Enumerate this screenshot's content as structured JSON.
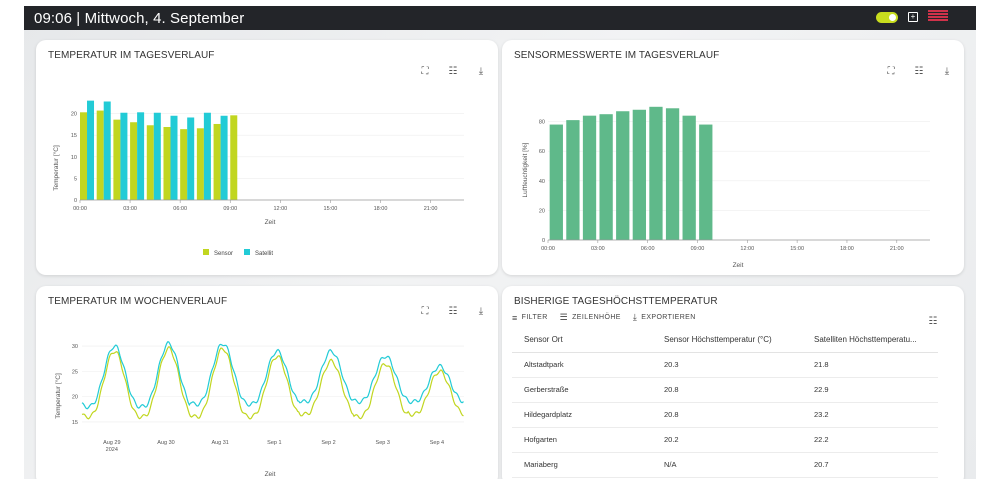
{
  "header": {
    "clock": "09:06 | Mittwoch, 4. September"
  },
  "colors": {
    "sensor": "#c1d620",
    "satellite": "#22cbd6",
    "humidity": "#5fb98a"
  },
  "icons": [
    "fullscreen-icon",
    "sliders-icon",
    "download-icon"
  ],
  "card1": {
    "title": "TEMPERATUR IM TAGESVERLAUF",
    "ylabel": "Temperatur [°C]",
    "xlabel": "Zeit",
    "legend": [
      "Sensor",
      "Satellit"
    ]
  },
  "card2": {
    "title": "SENSORMESSWERTE IM TAGESVERLAUF",
    "ylabel": "Luftfeuchtigkeit [%]",
    "xlabel": "Zeit"
  },
  "card3": {
    "title": "TEMPERATUR IM WOCHENVERLAUF",
    "ylabel": "Temperatur [°C]",
    "xlabel": "Zeit"
  },
  "card4": {
    "title": "BISHERIGE TAGESHÖCHSTTEMPERATUR",
    "toolbar": {
      "filter": "FILTER",
      "rowheight": "ZEILENHÖHE",
      "export": "EXPORTIEREN"
    },
    "columns": [
      "Sensor Ort",
      "Sensor Höchsttemperatur (°C)",
      "Satelliten Höchsttemperatu..."
    ],
    "rows": [
      [
        "Altstadtpark",
        "20.3",
        "21.8"
      ],
      [
        "Gerberstraße",
        "20.8",
        "22.9"
      ],
      [
        "Hildegardplatz",
        "20.8",
        "23.2"
      ],
      [
        "Hofgarten",
        "20.2",
        "22.2"
      ],
      [
        "Mariaberg",
        "N/A",
        "20.7"
      ]
    ]
  },
  "chart_data": [
    {
      "type": "bar",
      "x_ticks": [
        "00:00",
        "03:00",
        "06:00",
        "09:00",
        "12:00",
        "15:00",
        "18:00",
        "21:00"
      ],
      "ylim": [
        0,
        25
      ],
      "y_ticks": [
        0,
        5,
        10,
        15,
        20
      ],
      "x": [
        "00:00",
        "01:00",
        "02:00",
        "03:00",
        "04:00",
        "05:00",
        "06:00",
        "07:00",
        "08:00",
        "09:00"
      ],
      "series": [
        {
          "name": "Sensor",
          "values": [
            20.3,
            20.7,
            18.6,
            18.0,
            17.3,
            16.9,
            16.4,
            16.6,
            17.6,
            19.6
          ]
        },
        {
          "name": "Satellit",
          "values": [
            23.0,
            22.8,
            20.2,
            20.3,
            20.2,
            19.5,
            19.1,
            20.2,
            19.5,
            null
          ]
        }
      ],
      "ylabel": "Temperatur [°C]",
      "xlabel": "Zeit",
      "legend": "bottom",
      "grid": true
    },
    {
      "type": "bar",
      "x_ticks": [
        "00:00",
        "03:00",
        "06:00",
        "09:00",
        "12:00",
        "15:00",
        "18:00",
        "21:00"
      ],
      "ylim": [
        0,
        100
      ],
      "y_ticks": [
        0,
        20,
        40,
        60,
        80
      ],
      "x": [
        "00:00",
        "01:00",
        "02:00",
        "03:00",
        "04:00",
        "05:00",
        "06:00",
        "07:00",
        "08:00",
        "09:00"
      ],
      "values": [
        78,
        81,
        84,
        85,
        87,
        88,
        90,
        89,
        84,
        78
      ],
      "ylabel": "Luftfeuchtigkeit [%]",
      "xlabel": "Zeit",
      "grid": true
    },
    {
      "type": "line",
      "x_ticks": [
        "Aug 29\n2024",
        "Aug 30",
        "Aug 31",
        "Sep 1",
        "Sep 2",
        "Sep 3",
        "Sep 4"
      ],
      "ylim": [
        13,
        32
      ],
      "y_ticks": [
        15,
        20,
        25,
        30
      ],
      "series": [
        {
          "name": "Sensor",
          "min_max_per_day": [
            [
              16,
              29
            ],
            [
              16,
              29.5
            ],
            [
              16,
              29.5
            ],
            [
              16,
              28
            ],
            [
              16.5,
              27
            ],
            [
              16,
              26.5
            ],
            [
              16.5,
              25
            ]
          ]
        },
        {
          "name": "Satellit",
          "min_max_per_day": [
            [
              18,
              30
            ],
            [
              18,
              30.5
            ],
            [
              18.5,
              30.5
            ],
            [
              18.5,
              29
            ],
            [
              19,
              29
            ],
            [
              19,
              28
            ],
            [
              19,
              26
            ]
          ]
        }
      ],
      "ylabel": "Temperatur [°C]",
      "xlabel": "Zeit",
      "grid": true
    }
  ]
}
